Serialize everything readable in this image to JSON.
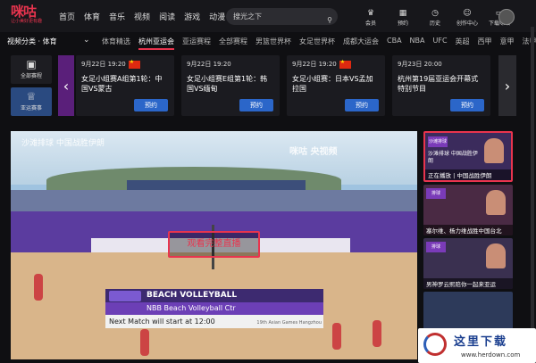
{
  "brand": {
    "logo": "咪咕",
    "tagline": "让小美好更有趣"
  },
  "nav": [
    "首页",
    "体育",
    "音乐",
    "视频",
    "阅读",
    "游戏",
    "动漫"
  ],
  "search": {
    "placeholder": "搜光之下"
  },
  "tools": [
    {
      "icon": "crown-icon",
      "label": "会员"
    },
    {
      "icon": "calendar-icon",
      "label": "预约"
    },
    {
      "icon": "history-icon",
      "label": "历史"
    },
    {
      "icon": "user-center-icon",
      "label": "创作中心"
    },
    {
      "icon": "download-icon",
      "label": "下载咪咕"
    }
  ],
  "category": {
    "current": "视频分类 · 体育",
    "items": [
      "体育精选",
      "杭州亚运会",
      "亚运赛程",
      "全部赛程",
      "男篮世界杯",
      "女足世界杯",
      "成都大运会",
      "CBA",
      "NBA",
      "UFC",
      "英超",
      "西甲",
      "意甲",
      "法甲"
    ]
  },
  "side": [
    {
      "label": "全部赛程",
      "icon": "calendar-check-icon"
    },
    {
      "label": "亚运赛事",
      "icon": "trophy-icon"
    }
  ],
  "schedule": [
    {
      "time": "9月22日 19:20",
      "title": "女足小组赛A组第1轮：中国VS蒙古",
      "button": "预约",
      "flag": true
    },
    {
      "time": "9月22日 19:20",
      "title": "女足小组赛E组第1轮：韩国VS缅甸",
      "button": "预约",
      "flag": false
    },
    {
      "time": "9月22日 19:20",
      "title": "女足小组赛：日本VS孟加拉国",
      "button": "预约",
      "flag": true
    },
    {
      "time": "9月23日 20:00",
      "title": "杭州第19届亚运会开幕式特别节目",
      "button": "预约",
      "flag": false
    }
  ],
  "video": {
    "overlay_title": "沙滩排球 中国战胜伊朗",
    "watermark": "咪咕 央视频",
    "play_button": "观看完整直播",
    "lower_third": {
      "sport": "BEACH VOLLEYBALL",
      "venue": "NBB Beach Volleyball Ctr",
      "next": "Next Match will start at 12:00",
      "event": "19th Asian Games Hangzhou"
    }
  },
  "related": [
    {
      "badge": "沙滩排球",
      "title": "正在播放 | 中国战胜伊朗",
      "overlay": "沙滩排球 中国战胜伊朗"
    },
    {
      "badge": "排球",
      "title": "塞尔维、杨力维战胜中国台北",
      "overlay": ""
    },
    {
      "badge": "排球",
      "title": "男神罗云熙陪你一起来亚运",
      "overlay": ""
    },
    {
      "badge": "",
      "title": "",
      "overlay": ""
    }
  ],
  "site_watermark": {
    "title": "这里下载",
    "url": "www.herdown.com"
  }
}
